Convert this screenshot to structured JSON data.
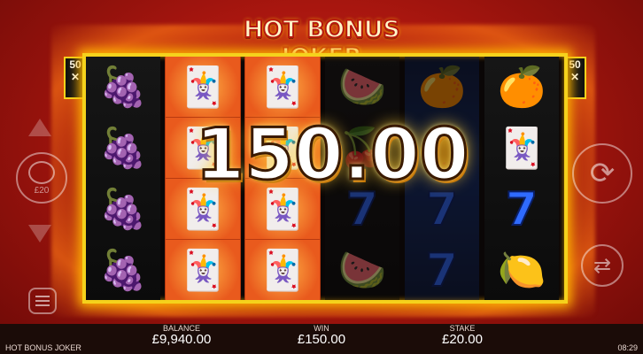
{
  "game": {
    "title": "HOT BONUS JOKER",
    "footer_name": "HOT BONUS JOKER",
    "clock": "08:29"
  },
  "lines_badge": {
    "count": "50",
    "mark": "✕"
  },
  "win_overlay": {
    "amount": "150.00"
  },
  "reels": [
    {
      "style": "dark",
      "symbols": [
        "plum",
        "plum",
        "grapes",
        "grapes"
      ]
    },
    {
      "style": "hot",
      "symbols": [
        "joker",
        "joker",
        "joker",
        "joker"
      ]
    },
    {
      "style": "hot",
      "symbols": [
        "joker",
        "joker",
        "joker",
        "joker"
      ]
    },
    {
      "style": "dark",
      "symbols": [
        "watermelon",
        "cherry",
        "seven",
        "watermelon"
      ],
      "dimmed": true
    },
    {
      "style": "blue",
      "symbols": [
        "orange",
        "orange",
        "seven",
        "seven"
      ],
      "dimmed": true
    },
    {
      "style": "dark",
      "symbols": [
        "orange",
        "joker",
        "seven",
        "lemon"
      ]
    }
  ],
  "symbol_glyphs": {
    "plum": "🍇",
    "grapes": "🍇",
    "joker": "🃏",
    "watermelon": "🍉",
    "cherry": "🍒",
    "seven": "7",
    "orange": "🍊",
    "lemon": "🍋"
  },
  "stake_chip": {
    "label": "£20"
  },
  "footer": {
    "balance_label": "BALANCE",
    "balance_value": "£9,940.00",
    "win_label": "WIN",
    "win_value": "£150.00",
    "stake_label": "STAKE",
    "stake_value": "£20.00"
  },
  "colors": {
    "frame": "#f5d21c",
    "background": "#a8160f",
    "seven_blue": "#2f6bff"
  }
}
